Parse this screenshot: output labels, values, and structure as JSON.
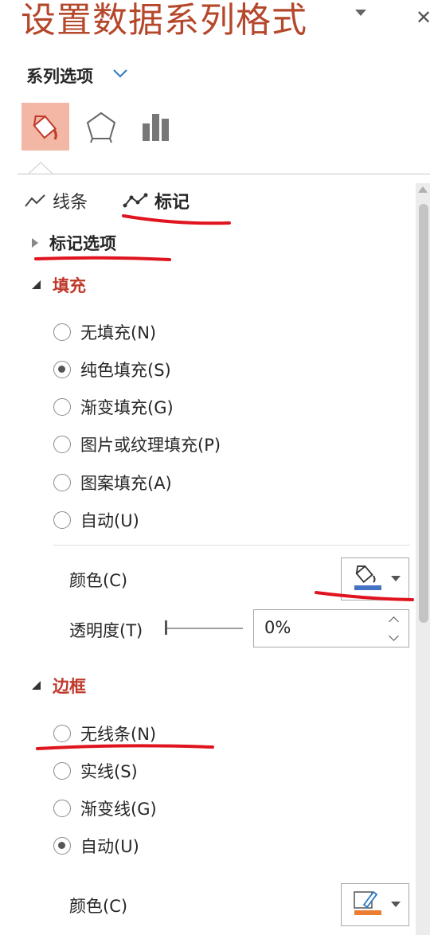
{
  "header": {
    "title": "设置数据系列格式",
    "series_options_label": "系列选项"
  },
  "tabs": [
    {
      "icon": "fill-line-icon",
      "active": true
    },
    {
      "icon": "effects-pentagon-icon",
      "active": false
    },
    {
      "icon": "series-options-chart-icon",
      "active": false
    }
  ],
  "subtabs": {
    "line": "线条",
    "marker": "标记"
  },
  "sections": {
    "marker_options": "标记选项",
    "fill": "填充",
    "border": "边框"
  },
  "fill": {
    "options": [
      {
        "label": "无填充(N)",
        "checked": false
      },
      {
        "label": "纯色填充(S)",
        "checked": true
      },
      {
        "label": "渐变填充(G)",
        "checked": false
      },
      {
        "label": "图片或纹理填充(P)",
        "checked": false
      },
      {
        "label": "图案填充(A)",
        "checked": false
      },
      {
        "label": "自动(U)",
        "checked": false
      }
    ],
    "color_label": "颜色(C)",
    "transparency_label": "透明度(T)",
    "transparency_value": "0%",
    "color_swatch": "#4472c4"
  },
  "border": {
    "options": [
      {
        "label": "无线条(N)",
        "checked": false
      },
      {
        "label": "实线(S)",
        "checked": false
      },
      {
        "label": "渐变线(G)",
        "checked": false
      },
      {
        "label": "自动(U)",
        "checked": true
      }
    ],
    "color_label": "颜色(C)",
    "color_swatch": "#ed7d31"
  },
  "colors": {
    "title": "#b5472b",
    "section_header": "#c0392b",
    "annotation": "#e0141e"
  }
}
